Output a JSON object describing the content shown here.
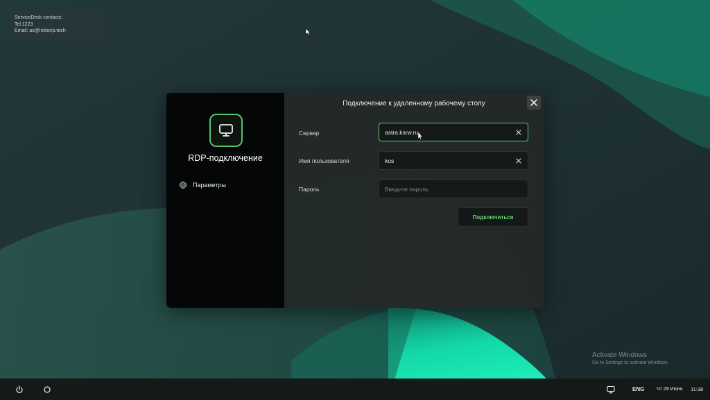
{
  "desktop": {
    "info": {
      "line1": "ServiceDesk contacts:",
      "line2": "Tel.1223",
      "line3": "Email: as@intiocrp.tech"
    },
    "watermark": {
      "title": "Activate Windows",
      "subtitle": "Go to Settings to activate Windows."
    }
  },
  "dialog": {
    "title": "Подключение к удаленному рабочему столу",
    "app_name": "RDP-подключение",
    "sidebar": {
      "params_label": "Параметры"
    },
    "fields": {
      "server": {
        "label": "Сервер",
        "value": "astra.ksrw.ru"
      },
      "username": {
        "label": "Имя пользователя",
        "value": "kos"
      },
      "password": {
        "label": "Пароль",
        "placeholder": "Введите пароль"
      }
    },
    "connect_label": "Подключиться"
  },
  "taskbar": {
    "lang": "ENG",
    "date": "Чт 29 Июня",
    "time": "11:38"
  },
  "colors": {
    "accent": "#5cd26d",
    "teal": "#17e8b3",
    "background": "#1f2f31"
  }
}
